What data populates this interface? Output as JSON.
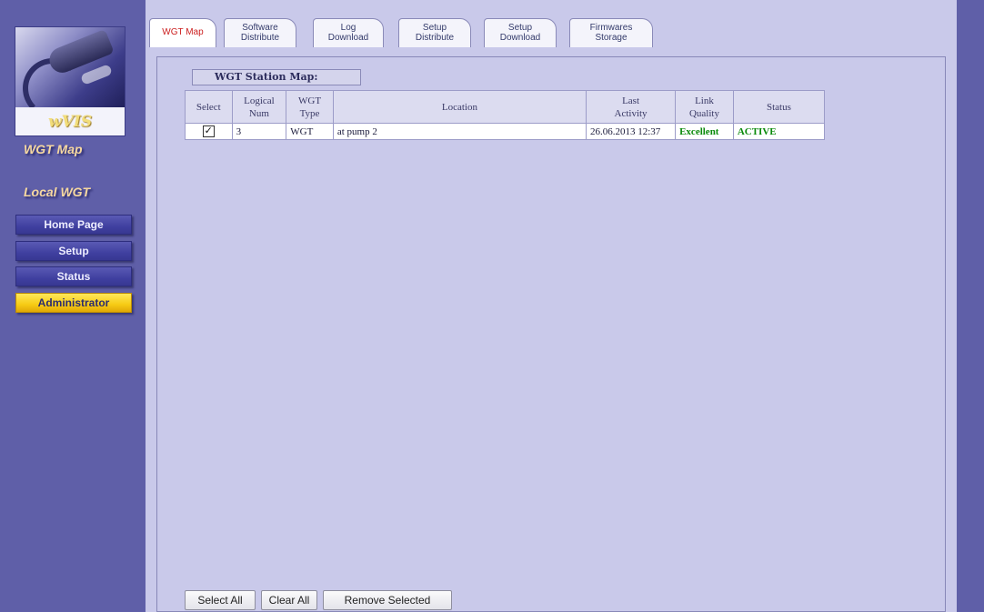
{
  "sidebar": {
    "logo_text": "wVIS",
    "section_title": "WGT Map",
    "subsection_title": "Local WGT",
    "buttons": [
      {
        "label": "Home Page"
      },
      {
        "label": "Setup"
      },
      {
        "label": "Status"
      },
      {
        "label": "Administrator",
        "active": true
      }
    ]
  },
  "tabs": [
    {
      "label": "WGT Map",
      "active": true
    },
    {
      "label": "Software\nDistribute"
    },
    {
      "label": "Log\nDownload"
    },
    {
      "label": "Setup\nDistribute"
    },
    {
      "label": "Setup\nDownload"
    },
    {
      "label": "Firmwares\nStorage"
    }
  ],
  "map": {
    "title": "WGT Station Map:",
    "columns": [
      "Select",
      "Logical\nNum",
      "WGT\nType",
      "Location",
      "Last\nActivity",
      "Link\nQuality",
      "Status"
    ],
    "rows": [
      {
        "selected": true,
        "logical_num": "3",
        "wgt_type": "WGT",
        "location": "at pump 2",
        "last_activity": "26.06.2013 12:37",
        "link_quality": "Excellent",
        "status": "ACTIVE"
      }
    ]
  },
  "actions": {
    "select_all": "Select All",
    "clear_all": "Clear All",
    "remove_selected": "Remove Selected"
  },
  "colors": {
    "background": "#5f5fa8",
    "panel": "#c9c9ea",
    "active_button": "#f6cb14",
    "status_green": "#0a8a0a"
  },
  "icons": {
    "checkbox_checked": "checkmark-icon",
    "logo": "fuel-nozzle-icon"
  }
}
